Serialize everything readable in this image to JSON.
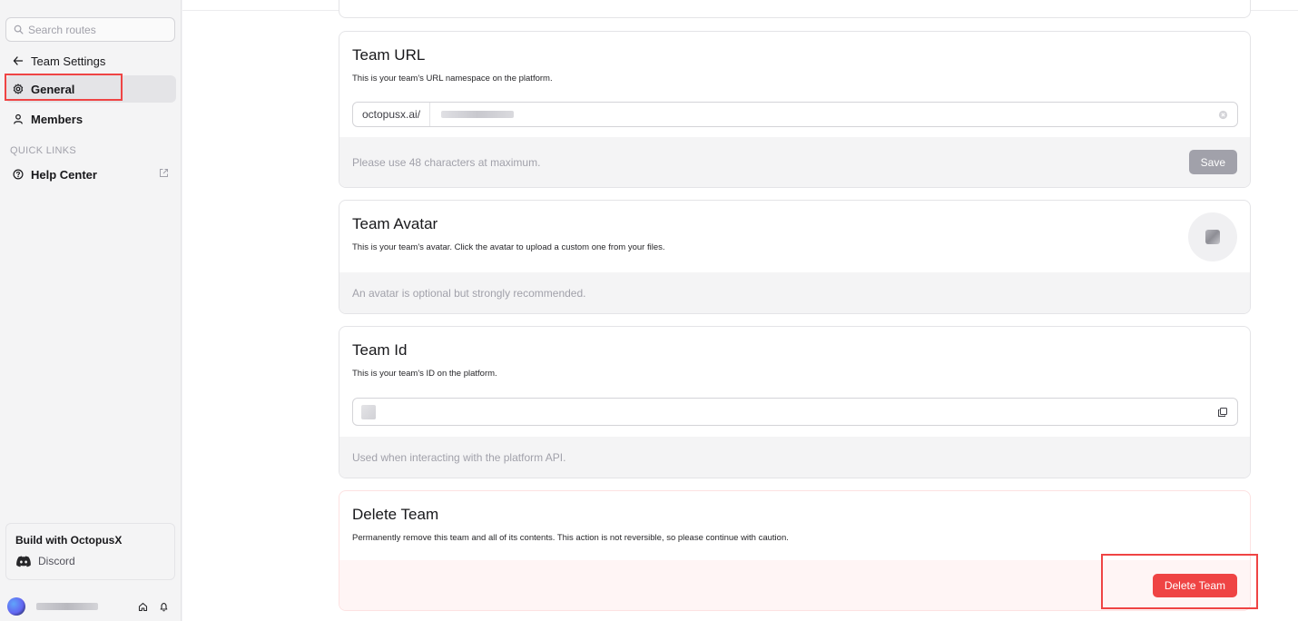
{
  "sidebar": {
    "search_placeholder": "Search routes",
    "back_label": "Team Settings",
    "items": [
      {
        "label": "General"
      },
      {
        "label": "Members"
      }
    ],
    "quick_links_label": "QUICK LINKS",
    "quick_links": [
      {
        "label": "Help Center"
      }
    ],
    "promo": {
      "title": "Build with OctopusX",
      "link_label": "Discord"
    }
  },
  "team_url": {
    "title": "Team URL",
    "description": "This is your team's URL namespace on the platform.",
    "prefix": "octopusx.ai/",
    "footer_note": "Please use 48 characters at maximum.",
    "save_label": "Save"
  },
  "team_avatar": {
    "title": "Team Avatar",
    "description": "This is your team's avatar. Click the avatar to upload a custom one from your files.",
    "footer_note": "An avatar is optional but strongly recommended."
  },
  "team_id": {
    "title": "Team Id",
    "description": "This is your team's ID on the platform.",
    "footer_note": "Used when interacting with the platform API."
  },
  "delete_team": {
    "title": "Delete Team",
    "description": "Permanently remove this team and all of its contents. This action is not reversible, so please continue with caution.",
    "button_label": "Delete Team"
  },
  "colors": {
    "accent_danger": "#ef4444",
    "highlight": "#ef4444",
    "save_disabled": "#a1a1aa"
  }
}
